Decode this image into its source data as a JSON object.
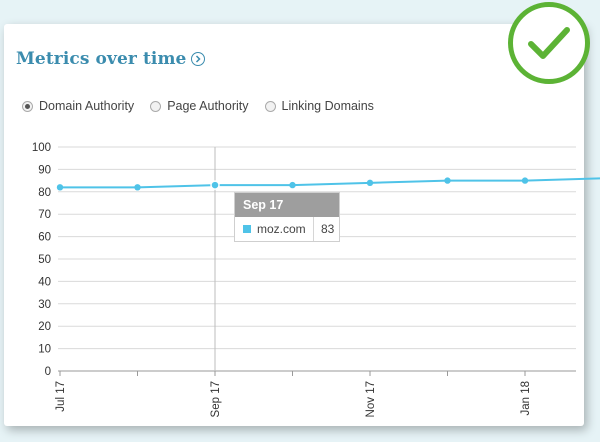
{
  "header": {
    "title": "Metrics over time"
  },
  "metric_options": [
    {
      "label": "Domain Authority",
      "selected": true
    },
    {
      "label": "Page Authority",
      "selected": false
    },
    {
      "label": "Linking Domains",
      "selected": false
    }
  ],
  "tooltip": {
    "date": "Sep 17",
    "series": "moz.com",
    "value": "83"
  },
  "colors": {
    "line": "#4fc3e8",
    "title": "#3b8cae",
    "check": "#5cb335"
  },
  "icons": {
    "info": "circle-chevron-right-icon",
    "badge": "checkmark-icon"
  },
  "chart_data": {
    "type": "line",
    "title": "Metrics over time",
    "xlabel": "",
    "ylabel": "",
    "ylim": [
      0,
      100
    ],
    "yticks": [
      0,
      10,
      20,
      30,
      40,
      50,
      60,
      70,
      80,
      90,
      100
    ],
    "x": [
      "Jul 17",
      "Aug 17",
      "Sep 17",
      "Oct 17",
      "Nov 17",
      "Dec 17",
      "Jan 18",
      "Feb 18"
    ],
    "xtick_labels": [
      "Jul 17",
      "Sep 17",
      "Nov 17",
      "Jan 18"
    ],
    "grid": true,
    "series": [
      {
        "name": "moz.com",
        "values": [
          82,
          82,
          83,
          83,
          84,
          85,
          85,
          86
        ]
      }
    ]
  }
}
